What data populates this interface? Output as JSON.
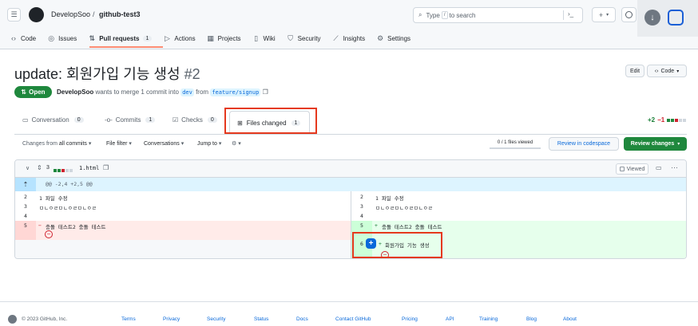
{
  "header": {
    "owner": "DevelopSoo",
    "separator": "/",
    "repo": "github-test3",
    "search_placeholder": "Type",
    "search_slash": "/",
    "search_suffix": "to search",
    "new_label": "+",
    "terminal": "›_"
  },
  "nav": {
    "items": [
      {
        "label": "Code",
        "icon": "code-icon"
      },
      {
        "label": "Issues",
        "icon": "issue-icon"
      },
      {
        "label": "Pull requests",
        "icon": "pull-request-icon",
        "count": "1"
      },
      {
        "label": "Actions",
        "icon": "play-icon"
      },
      {
        "label": "Projects",
        "icon": "table-icon"
      },
      {
        "label": "Wiki",
        "icon": "book-icon"
      },
      {
        "label": "Security",
        "icon": "shield-icon"
      },
      {
        "label": "Insights",
        "icon": "graph-icon"
      },
      {
        "label": "Settings",
        "icon": "gear-icon"
      }
    ]
  },
  "pr": {
    "title": "update: 회원가입 기능 생성",
    "number": "#2",
    "status": "Open",
    "author": "DevelopSoo",
    "meta_text": "wants to merge 1 commit into",
    "base_branch": "dev",
    "from_text": "from",
    "head_branch": "feature/signup",
    "edit_label": "Edit",
    "code_label": "Code"
  },
  "tabs": [
    {
      "label": "Conversation",
      "count": "0"
    },
    {
      "label": "Commits",
      "count": "1"
    },
    {
      "label": "Checks",
      "count": "0"
    },
    {
      "label": "Files changed",
      "count": "1"
    }
  ],
  "diffstat": {
    "added": "+2",
    "removed": "−1"
  },
  "toolbar": {
    "changes_from_prefix": "Changes from",
    "changes_from_value": "all commits",
    "file_filter": "File filter",
    "conversations": "Conversations",
    "jump_to": "Jump to",
    "files_viewed": "0 / 1 files viewed",
    "review_codespace": "Review in codespace",
    "review_changes": "Review changes"
  },
  "file": {
    "change_count": "3",
    "name": "1.html",
    "viewed_label": "Viewed",
    "hunk": "@@ -2,4 +2,5 @@"
  },
  "diff_left": [
    {
      "num": "2",
      "sign": " ",
      "text": "1 파일 수정"
    },
    {
      "num": "3",
      "sign": " ",
      "text": "ㅁㄴㅇㄹㅁㄴㅇㄹㅁㄴㅇㄹ"
    },
    {
      "num": "4",
      "sign": " ",
      "text": ""
    },
    {
      "num": "5",
      "sign": "−",
      "text": "충돌 테스트2 충돌 테스트"
    }
  ],
  "diff_right": [
    {
      "num": "2",
      "sign": " ",
      "text": "1 파일 수정"
    },
    {
      "num": "3",
      "sign": " ",
      "text": "ㅁㄴㅇㄹㅁㄴㅇㄹㅁㄴㅇㄹ"
    },
    {
      "num": "4",
      "sign": " ",
      "text": ""
    },
    {
      "num": "5",
      "sign": "+",
      "text": "충돌 테스트2 충돌 테스트"
    },
    {
      "num": "6",
      "sign": "+",
      "text": "회원가입 기능 생성"
    }
  ],
  "footer": {
    "copyright": "© 2023 GitHub, Inc.",
    "links": [
      "Terms",
      "Privacy",
      "Security",
      "Status",
      "Docs",
      "Contact GitHub",
      "Pricing",
      "API",
      "Training",
      "Blog",
      "About"
    ]
  },
  "colors": {
    "accent": "#0969da",
    "green": "#1f883d",
    "red": "#cf222e",
    "highlight": "#e5391e"
  }
}
